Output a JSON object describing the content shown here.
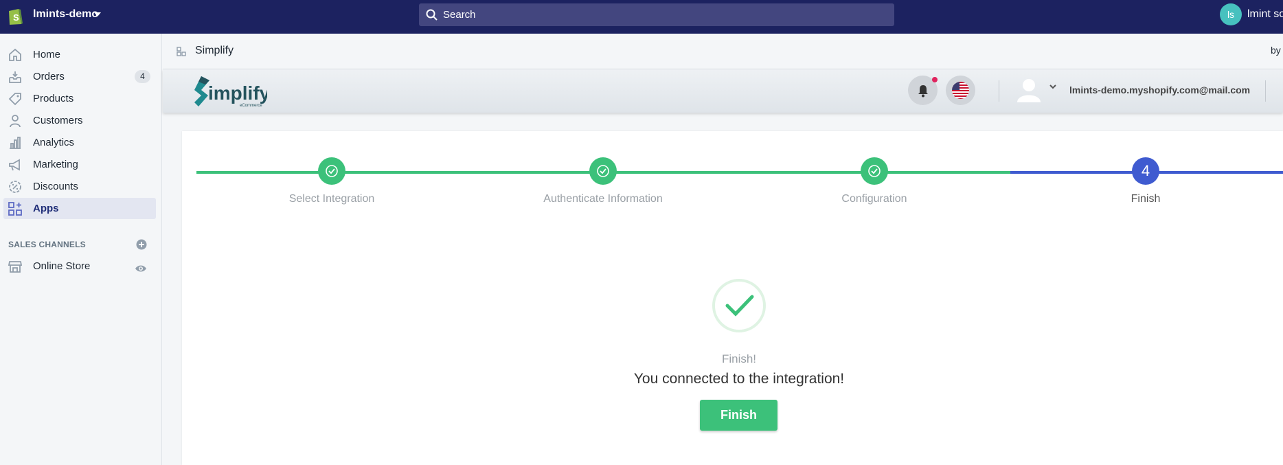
{
  "topbar": {
    "store_name": "lmints-demo",
    "search_placeholder": "Search",
    "avatar_initials": "ls",
    "user_name": "lmint sol"
  },
  "sidebar": {
    "items": [
      {
        "label": "Home",
        "icon": "home-icon"
      },
      {
        "label": "Orders",
        "icon": "orders-icon",
        "badge": "4"
      },
      {
        "label": "Products",
        "icon": "tag-icon"
      },
      {
        "label": "Customers",
        "icon": "person-icon"
      },
      {
        "label": "Analytics",
        "icon": "bar-chart-icon"
      },
      {
        "label": "Marketing",
        "icon": "megaphone-icon"
      },
      {
        "label": "Discounts",
        "icon": "discount-icon"
      },
      {
        "label": "Apps",
        "icon": "apps-icon",
        "active": true
      }
    ],
    "sales_channels_title": "SALES CHANNELS",
    "online_store_label": "Online Store"
  },
  "app_header": {
    "title": "Simplify",
    "by_text": "by"
  },
  "embed": {
    "logo_text": "implify",
    "logo_sub": "eCommerce",
    "user_email": "lmints-demo.myshopify.com@mail.com"
  },
  "steps": [
    {
      "label": "Select Integration",
      "status": "done"
    },
    {
      "label": "Authenticate Information",
      "status": "done"
    },
    {
      "label": "Configuration",
      "status": "done"
    },
    {
      "label": "Finish",
      "status": "current",
      "number": "4"
    }
  ],
  "finish": {
    "subtitle": "Finish!",
    "message": "You connected to the integration!",
    "button_label": "Finish"
  },
  "colors": {
    "topbar": "#1c2260",
    "success": "#3cc17a",
    "current_step": "#3f5bd0"
  }
}
